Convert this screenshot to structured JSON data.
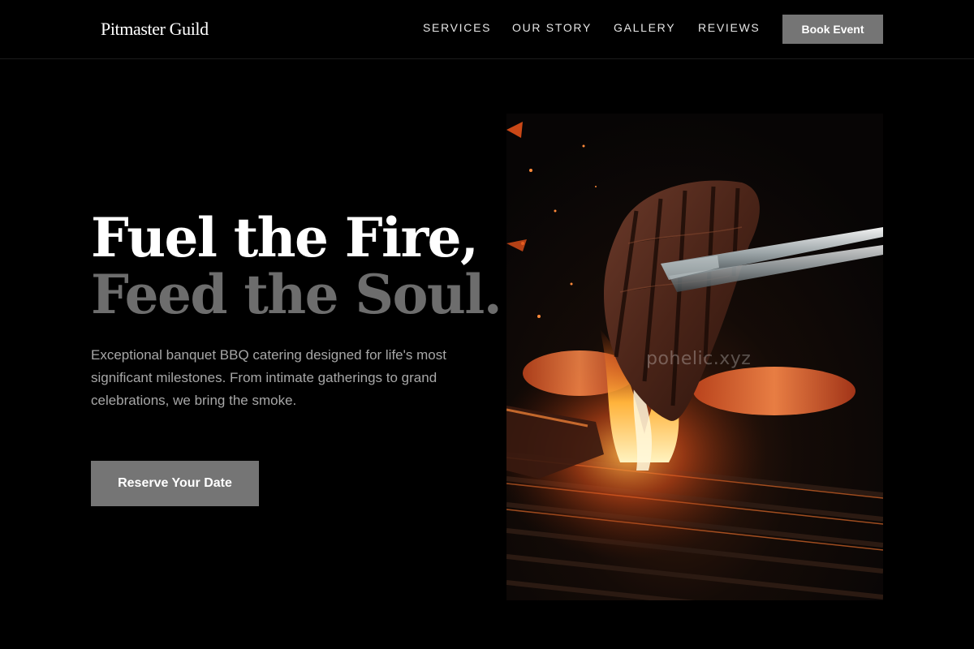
{
  "header": {
    "logo": "Pitmaster Guild",
    "nav": [
      "SERVICES",
      "OUR STORY",
      "GALLERY",
      "REVIEWS"
    ],
    "cta_label": "Book Event"
  },
  "hero": {
    "title_line1": "Fuel the Fire,",
    "title_line2": "Feed the Soul.",
    "description": "Exceptional banquet BBQ catering designed for life's most significant milestones. From intimate gatherings to grand celebrations, we bring the smoke.",
    "cta_label": "Reserve Your Date"
  },
  "image": {
    "subject": "steak held by tongs over flaming grill",
    "watermark": "pohelic.xyz"
  },
  "colors": {
    "background": "#000000",
    "button": "#757575",
    "title_muted": "#6d6d6d",
    "body_text": "#a7a7a7"
  }
}
